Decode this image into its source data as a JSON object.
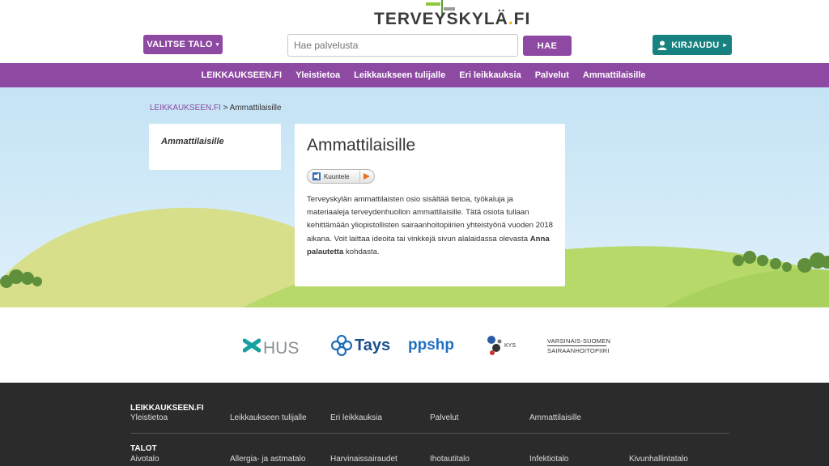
{
  "header": {
    "logo_text": "TERVEYSKYLÄ",
    "logo_dot": ".",
    "logo_suffix": "FI",
    "house_select_label": "VALITSE TALO",
    "search_placeholder": "Hae palvelusta",
    "search_button": "HAE",
    "login_button": "KIRJAUDU"
  },
  "nav": {
    "items": [
      "LEIKKAUKSEEN.FI",
      "Yleistietoa",
      "Leikkaukseen tulijalle",
      "Eri leikkauksia",
      "Palvelut",
      "Ammattilaisille"
    ]
  },
  "breadcrumb": {
    "home": "LEIKKAUKSEEN.FI",
    "separator": ">",
    "current": "Ammattilaisille"
  },
  "sidebar": {
    "item": "Ammattilaisille"
  },
  "content": {
    "title": "Ammattilaisille",
    "listen_label": "Kuuntele",
    "paragraph_before": "Terveyskylän ammattilaisten osio sisältää tietoa, työkaluja ja materiaaleja terveydenhuollon ammattilaisille. Tätä osiota tullaan kehittämään yliopistollisten sairaanhoitopiirien yhteistyönä vuoden 2018 aikana. Voit laittaa ideoita tai vinkkejä sivun alalaidassa olevasta ",
    "paragraph_bold": "Anna palautetta",
    "paragraph_after": " kohdasta."
  },
  "partners": {
    "hus": "HUS",
    "tays": "Tays",
    "ppshp": "ppshp",
    "kys": "KYS",
    "vs_line1": "VARSINAIS-SUOMEN",
    "vs_line2": "SAIRAANHOITOPIIRI"
  },
  "footer": {
    "section1_title": "LEIKKAUKSEEN.FI",
    "section1_links": [
      "Yleistietoa",
      "Leikkaukseen tulijalle",
      "Eri leikkauksia",
      "Palvelut",
      "Ammattilaisille"
    ],
    "section2_title": "TALOT",
    "section2_links": [
      "Aivotalo",
      "Allergia- ja astmatalo",
      "Harvinaissairaudet",
      "Ihotautitalo",
      "Infektiotalo",
      "Kivunhallintatalo"
    ]
  },
  "colors": {
    "brand_purple": "#8e4aa3",
    "login_teal": "#17827f",
    "footer_bg": "#2b2b2b"
  }
}
